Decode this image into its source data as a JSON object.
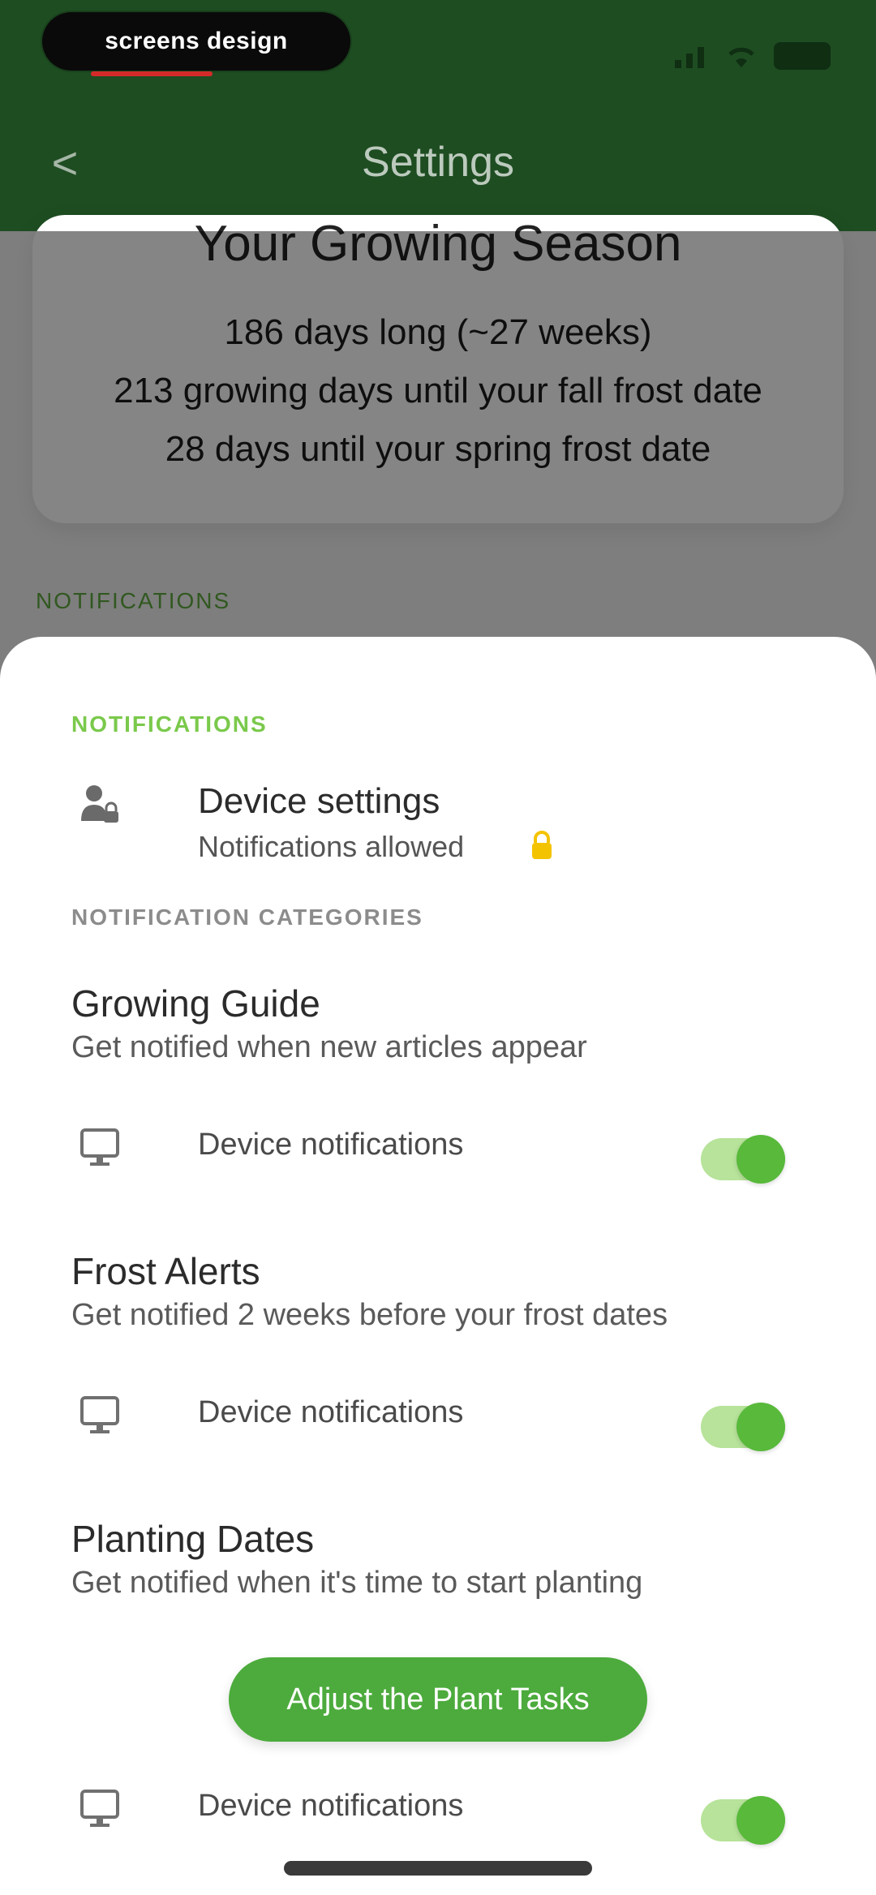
{
  "status_bar": {
    "logo_text": "screens design"
  },
  "nav": {
    "back_label": "<",
    "title": "Settings"
  },
  "growing_season": {
    "title": "Your Growing Season",
    "lines": [
      "186 days long (~27 weeks)",
      "213 growing days until your fall frost date",
      "28 days until your spring frost date"
    ]
  },
  "background": {
    "section_label": "NOTIFICATIONS"
  },
  "sheet": {
    "section_label": "NOTIFICATIONS",
    "device_settings": {
      "title": "Device settings",
      "status": "Notifications allowed"
    },
    "categories_label": "NOTIFICATION CATEGORIES",
    "categories": [
      {
        "title": "Growing Guide",
        "subtitle": "Get notified when new articles appear",
        "device_label": "Device notifications",
        "enabled": true
      },
      {
        "title": "Frost Alerts",
        "subtitle": "Get notified 2 weeks before your frost dates",
        "device_label": "Device notifications",
        "enabled": true
      },
      {
        "title": "Planting Dates",
        "subtitle": "Get notified when it's time to start planting",
        "device_label": "Device notifications",
        "enabled": true
      }
    ],
    "adjust_button_label": "Adjust the Plant Tasks"
  },
  "colors": {
    "header_green": "#1e4d22",
    "accent_green": "#58b93a",
    "section_label_green": "#7ac94b"
  },
  "icons": {
    "back": "chevron-left-icon",
    "device_settings": "person-lock-icon",
    "device_row": "monitor-icon",
    "lock": "lock-icon"
  }
}
